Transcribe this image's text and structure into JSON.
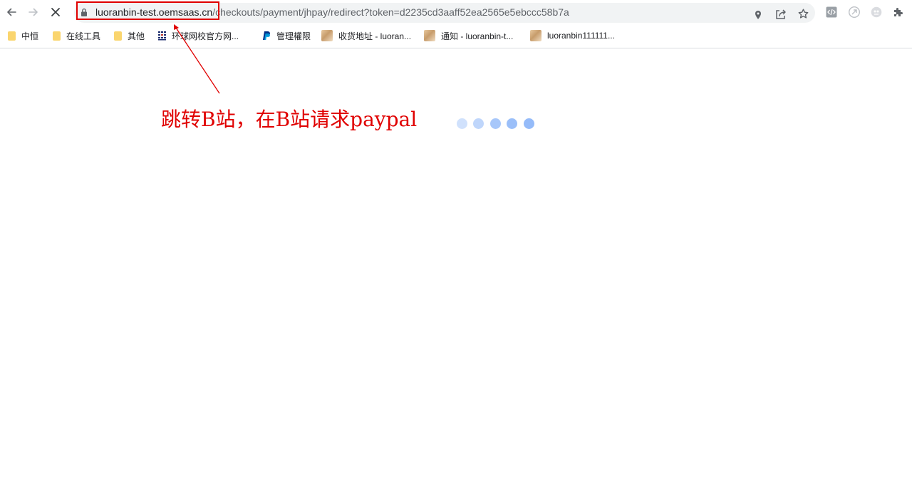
{
  "browser": {
    "url_host": "luoranbin-test.oemsaas.cn",
    "url_path": "/checkouts/payment/jhpay/redirect?token=d2235cd3aaff52ea2565e5ebccc58b7a",
    "icons": [
      "back-icon",
      "forward-icon",
      "stop-icon",
      "lock-icon",
      "location-icon",
      "share-icon",
      "star-icon",
      "devtools-extension-icon",
      "extension-icon-2",
      "extension-icon-3",
      "puzzle-icon"
    ]
  },
  "bookmarks": [
    {
      "label": "中恒",
      "icon": "folder-icon"
    },
    {
      "label": "在线工具",
      "icon": "folder-icon"
    },
    {
      "label": "其他",
      "icon": "folder-icon"
    },
    {
      "label": "环球网校官方网...",
      "icon": "site-icon"
    },
    {
      "label": "管理權限",
      "icon": "paypal-icon"
    },
    {
      "label": "收货地址 - luoran...",
      "icon": "avatar-icon"
    },
    {
      "label": "通知 - luoranbin-t...",
      "icon": "avatar-icon"
    },
    {
      "label": "luoranbin111111...",
      "icon": "avatar-icon"
    }
  ],
  "annotation": {
    "text": "跳转B站，在B站请求paypal",
    "color": "#e00000"
  },
  "loader": {
    "dot_count": 5,
    "dot_opacities": [
      0.4,
      0.55,
      0.75,
      0.85,
      0.9
    ],
    "color": "#8ab4f8"
  }
}
